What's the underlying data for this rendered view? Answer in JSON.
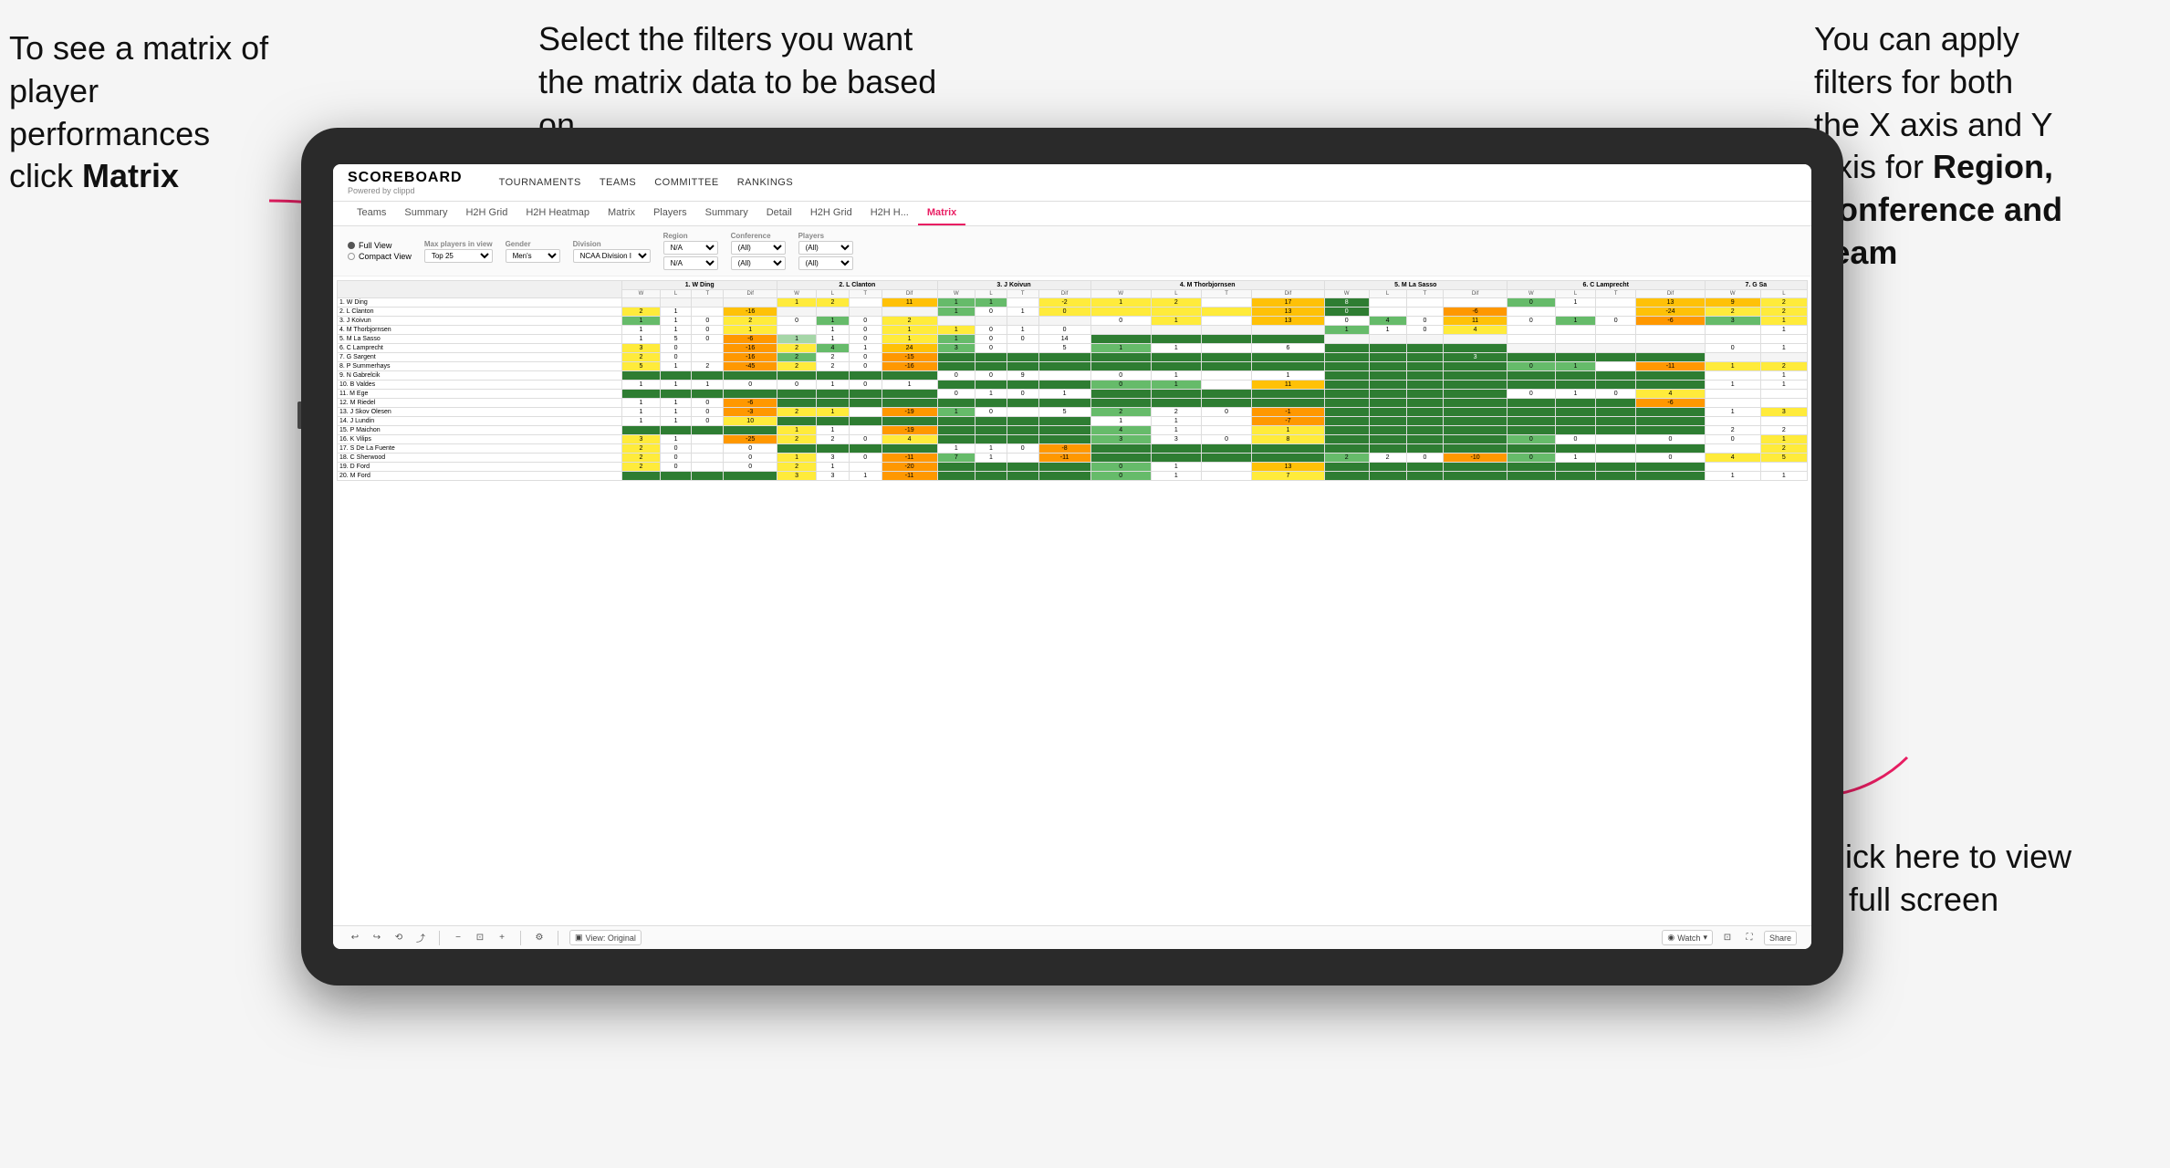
{
  "annotations": {
    "topleft": {
      "line1": "To see a matrix of",
      "line2": "player performances",
      "line3_plain": "click ",
      "line3_bold": "Matrix"
    },
    "topcenter": {
      "text": "Select the filters you want the matrix data to be based on"
    },
    "topright": {
      "line1": "You  can apply",
      "line2": "filters for both",
      "line3": "the X axis and Y",
      "line4_plain": "Axis for ",
      "line4_bold": "Region,",
      "line5_bold": "Conference and",
      "line6_bold": "Team"
    },
    "bottomright": {
      "line1": "Click here to view",
      "line2": "in full screen"
    }
  },
  "app": {
    "logo": "SCOREBOARD",
    "logo_sub": "Powered by clippd",
    "main_nav": [
      "TOURNAMENTS",
      "TEAMS",
      "COMMITTEE",
      "RANKINGS"
    ],
    "sub_nav": [
      "Teams",
      "Summary",
      "H2H Grid",
      "H2H Heatmap",
      "Matrix",
      "Players",
      "Summary",
      "Detail",
      "H2H Grid",
      "H2H H...",
      "Matrix"
    ],
    "active_tab": "Matrix"
  },
  "filters": {
    "view_options": [
      "Full View",
      "Compact View"
    ],
    "selected_view": "Full View",
    "max_players_label": "Max players in view",
    "max_players_value": "Top 25",
    "gender_label": "Gender",
    "gender_value": "Men's",
    "division_label": "Division",
    "division_value": "NCAA Division I",
    "region_label": "Region",
    "region_value1": "N/A",
    "region_value2": "N/A",
    "conference_label": "Conference",
    "conference_value1": "(All)",
    "conference_value2": "(All)",
    "players_label": "Players",
    "players_value1": "(All)",
    "players_value2": "(All)"
  },
  "matrix": {
    "col_headers": [
      "1. W Ding",
      "2. L Clanton",
      "3. J Koivun",
      "4. M Thorbjornsen",
      "5. M La Sasso",
      "6. C Lamprecht",
      "7. G Sa"
    ],
    "sub_cols": [
      "W",
      "L",
      "T",
      "Dif"
    ],
    "rows": [
      {
        "name": "1. W Ding"
      },
      {
        "name": "2. L Clanton"
      },
      {
        "name": "3. J Koivun"
      },
      {
        "name": "4. M Thorbjornsen"
      },
      {
        "name": "5. M La Sasso"
      },
      {
        "name": "6. C Lamprecht"
      },
      {
        "name": "7. G Sargent"
      },
      {
        "name": "8. P Summerhays"
      },
      {
        "name": "9. N Gabrelcik"
      },
      {
        "name": "10. B Valdes"
      },
      {
        "name": "11. M Ege"
      },
      {
        "name": "12. M Riedel"
      },
      {
        "name": "13. J Skov Olesen"
      },
      {
        "name": "14. J Lundin"
      },
      {
        "name": "15. P Maichon"
      },
      {
        "name": "16. K Vilips"
      },
      {
        "name": "17. S De La Fuente"
      },
      {
        "name": "18. C Sherwood"
      },
      {
        "name": "19. D Ford"
      },
      {
        "name": "20. M Ford"
      }
    ]
  },
  "toolbar": {
    "view_label": "View: Original",
    "watch_label": "Watch",
    "share_label": "Share"
  }
}
